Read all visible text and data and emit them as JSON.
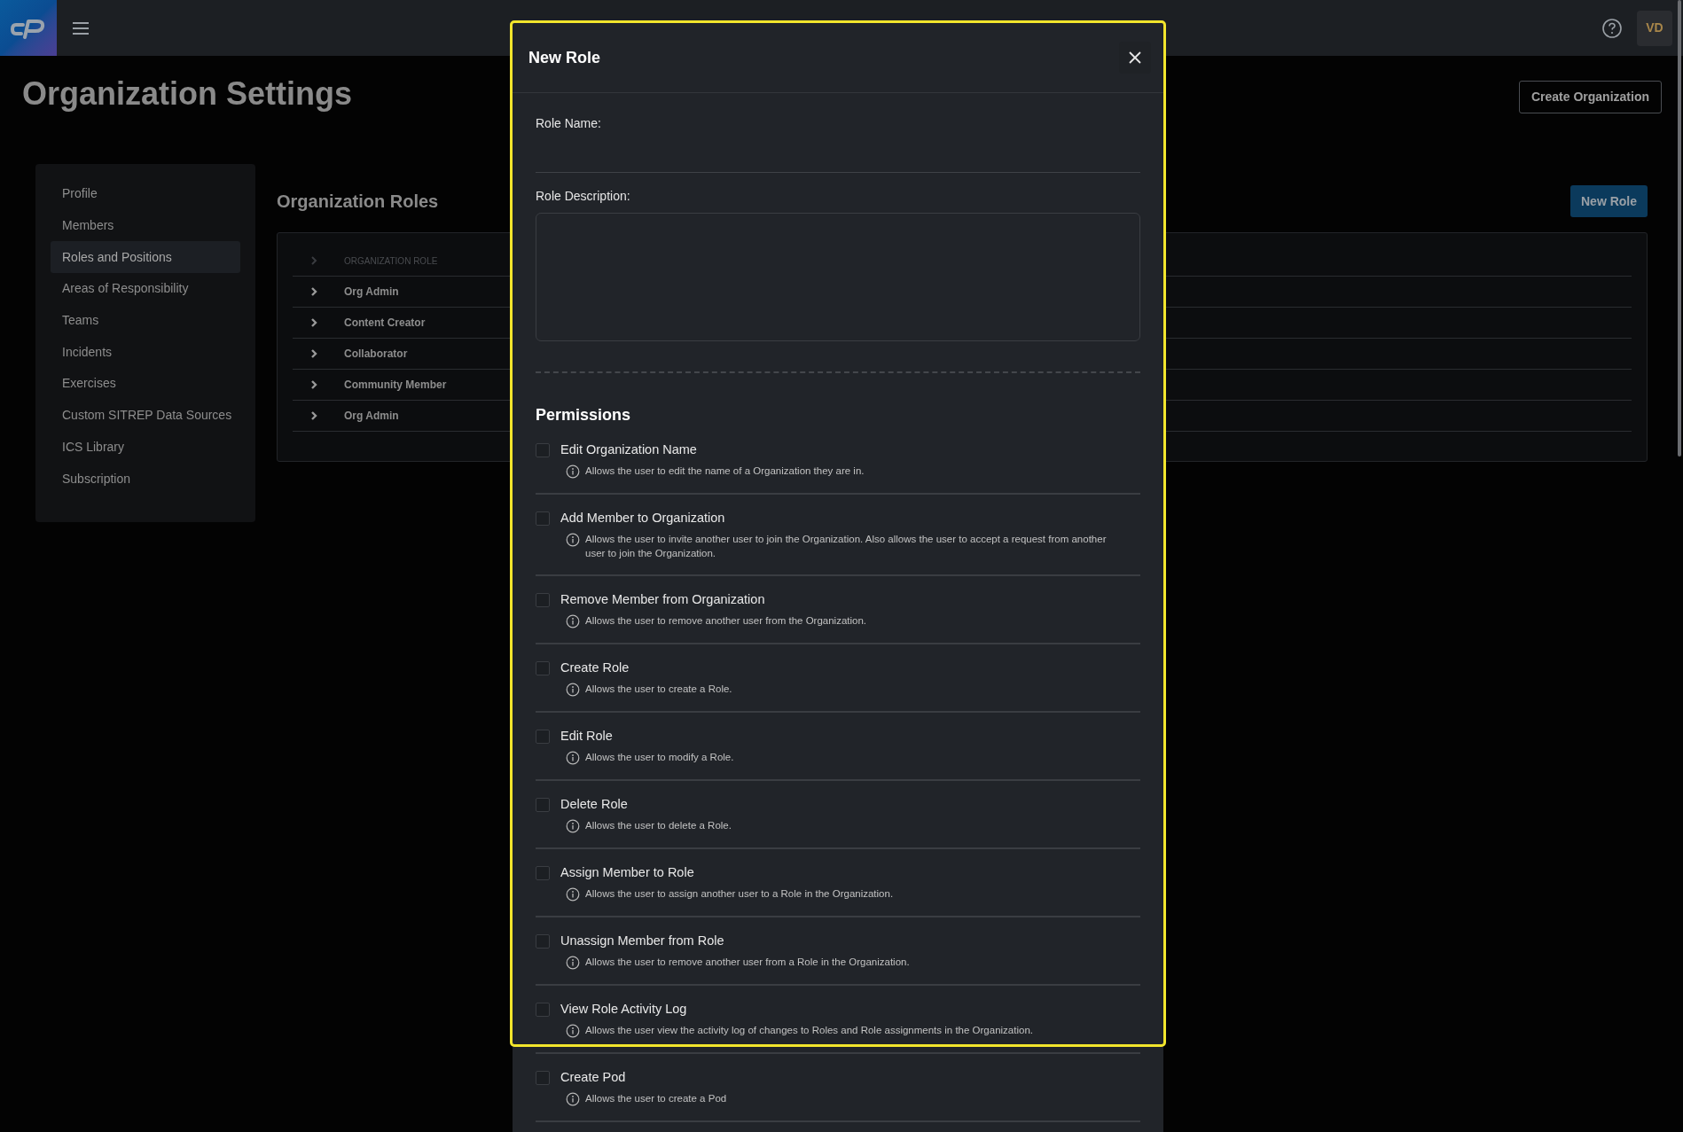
{
  "app_bar": {
    "avatar_initials": "VD"
  },
  "page": {
    "title": "Organization Settings",
    "create_button": "Create Organization"
  },
  "sidebar": {
    "items": [
      {
        "label": "Profile",
        "selected": false
      },
      {
        "label": "Members",
        "selected": false
      },
      {
        "label": "Roles and Positions",
        "selected": true
      },
      {
        "label": "Areas of Responsibility",
        "selected": false
      },
      {
        "label": "Teams",
        "selected": false
      },
      {
        "label": "Incidents",
        "selected": false
      },
      {
        "label": "Exercises",
        "selected": false
      },
      {
        "label": "Custom SITREP Data Sources",
        "selected": false
      },
      {
        "label": "ICS Library",
        "selected": false
      },
      {
        "label": "Subscription",
        "selected": false
      }
    ]
  },
  "roles": {
    "title": "Organization Roles",
    "new_button": "New Role",
    "column": "ORGANIZATION ROLE",
    "rows": [
      {
        "name": "Org Admin",
        "expanded": false
      },
      {
        "name": "Content Creator",
        "expanded": false
      },
      {
        "name": "Collaborator",
        "expanded": false
      },
      {
        "name": "Community Member",
        "expanded": false
      },
      {
        "name": "Org Admin",
        "expanded": false
      }
    ]
  },
  "modal": {
    "title": "New Role",
    "fields": [
      {
        "label": "Role Name:",
        "kind": "input"
      },
      {
        "label": "Role Description:",
        "kind": "textarea"
      }
    ],
    "permissions_title": "Permissions",
    "permissions": [
      {
        "name": "Edit Organization Name",
        "description": "Allows the user to edit the name of a Organization they are in.",
        "checked": false
      },
      {
        "name": "Add Member to Organization",
        "description": "Allows the user to invite another user to join the Organization. Also allows the user to accept a request from another user to join the Organization.",
        "checked": false
      },
      {
        "name": "Remove Member from Organization",
        "description": "Allows the user to remove another user from the Organization.",
        "checked": false
      },
      {
        "name": "Create Role",
        "description": "Allows the user to create a Role.",
        "checked": false
      },
      {
        "name": "Edit Role",
        "description": "Allows the user to modify a Role.",
        "checked": false
      },
      {
        "name": "Delete Role",
        "description": "Allows the user to delete a Role.",
        "checked": false
      },
      {
        "name": "Assign Member to Role",
        "description": "Allows the user to assign another user to a Role in the Organization.",
        "checked": false
      },
      {
        "name": "Unassign Member from Role",
        "description": "Allows the user to remove another user from a Role in the Organization.",
        "checked": false
      },
      {
        "name": "View Role Activity Log",
        "description": "Allows the user view the activity log of changes to Roles and Role assignments in the Organization.",
        "checked": false
      },
      {
        "name": "Create Pod",
        "description": "Allows the user to create a Pod",
        "checked": false
      }
    ]
  }
}
